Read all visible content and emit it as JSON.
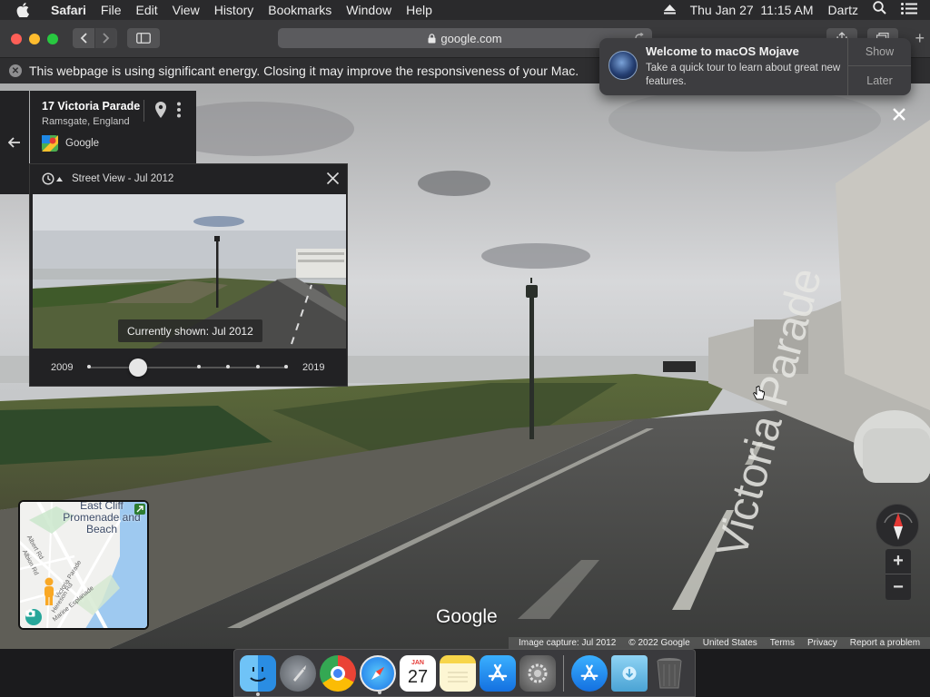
{
  "menubar": {
    "app": "Safari",
    "items": [
      "File",
      "Edit",
      "View",
      "History",
      "Bookmarks",
      "Window",
      "Help"
    ],
    "datetime": "Thu Jan 27  11:15 AM",
    "user": "Dartz"
  },
  "toolbar": {
    "url": "google.com"
  },
  "energy_banner": {
    "text": "This webpage is using significant energy. Closing it may improve the responsiveness of your Mac."
  },
  "notification": {
    "title": "Welcome to macOS Mojave",
    "body": "Take a quick tour to learn about great new features.",
    "show_label": "Show",
    "later_label": "Later"
  },
  "place": {
    "street": "17 Victoria Parade",
    "city": "Ramsgate, England",
    "brand": "Google"
  },
  "timeline": {
    "header": "Street View - Jul 2012",
    "caption": "Currently shown: Jul 2012",
    "start_year": "2009",
    "end_year": "2019",
    "selected_fraction": 0.25
  },
  "minimap": {
    "area_label": "East Cliff Promenade and Beach",
    "roads": [
      "Albert Rd",
      "Albion Rd",
      "Victoria Parade",
      "Marine Esplanade",
      "Hereson Rd"
    ]
  },
  "streetview": {
    "road_name": "Victoria Parade",
    "logo": "Google"
  },
  "footer": {
    "capture": "Image capture: Jul 2012",
    "copyright": "© 2022 Google",
    "region": "United States",
    "terms": "Terms",
    "privacy": "Privacy",
    "report": "Report a problem"
  },
  "dock": {
    "apps": [
      "Finder",
      "Launchpad",
      "Google Chrome",
      "Safari",
      "Calendar",
      "Notes",
      "App Store",
      "System Preferences",
      "App Store",
      "Downloads",
      "Trash"
    ],
    "calendar_month": "JAN",
    "calendar_day": "27"
  },
  "colors": {
    "accent": "#0a84ff",
    "traffic_red": "#fe5f57",
    "traffic_yellow": "#febc2e",
    "traffic_green": "#28c840"
  }
}
